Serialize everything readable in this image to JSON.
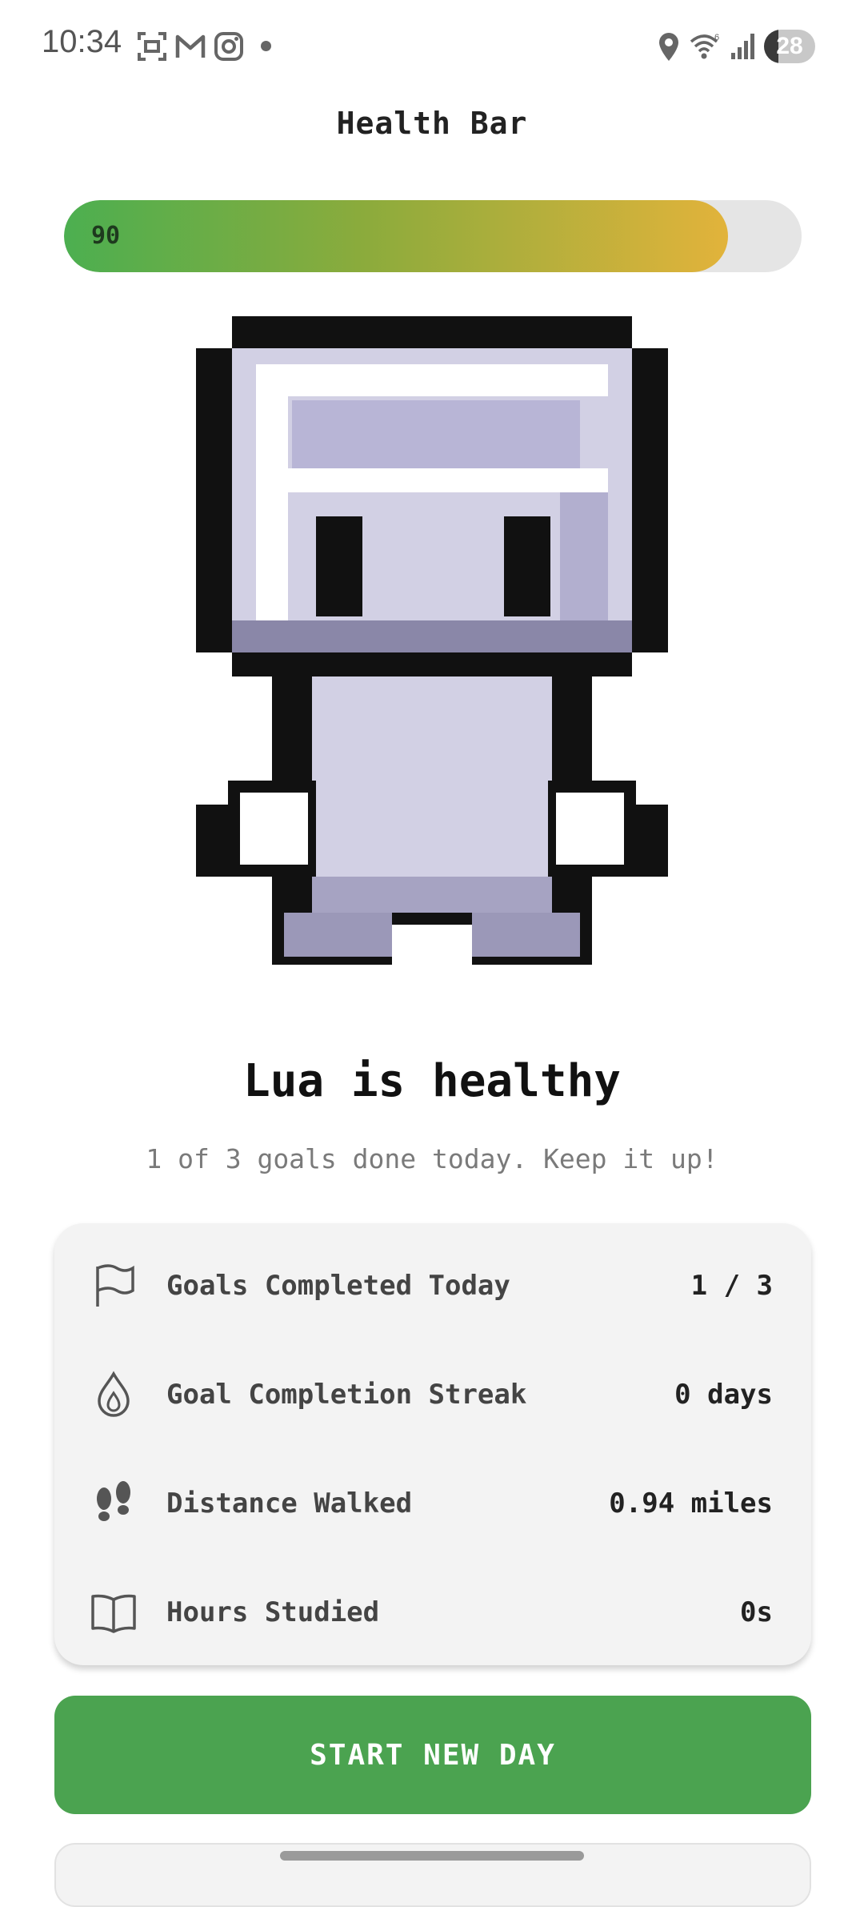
{
  "status_bar": {
    "time": "10:34",
    "battery": "28",
    "battery_level_percent": 28,
    "icons": [
      "screenshot-icon",
      "gmail-icon",
      "instagram-icon",
      "notification-dot-icon",
      "location-icon",
      "wifi-icon",
      "signal-icon"
    ]
  },
  "header": {
    "title": "Health Bar"
  },
  "health": {
    "value": "90",
    "level_percent": 90,
    "colors": {
      "start": "#4caf50",
      "end": "#e2b33b",
      "track": "#e5e5e5"
    }
  },
  "character": {
    "icon": "pixel-robot-character"
  },
  "status": {
    "heading": "Lua is healthy",
    "subtext": "1 of 3 goals done today. Keep it up!"
  },
  "stats": [
    {
      "icon": "flag-icon",
      "label": "Goals Completed Today",
      "value": "1 / 3"
    },
    {
      "icon": "flame-icon",
      "label": "Goal Completion Streak",
      "value": "0 days"
    },
    {
      "icon": "footprints-icon",
      "label": "Distance Walked",
      "value": "0.94 miles"
    },
    {
      "icon": "book-icon",
      "label": "Hours Studied",
      "value": "0s"
    }
  ],
  "actions": {
    "start_new_day": "START NEW DAY"
  },
  "theme": {
    "accent_green": "#4ba350",
    "card_background": "#f3f3f3"
  }
}
